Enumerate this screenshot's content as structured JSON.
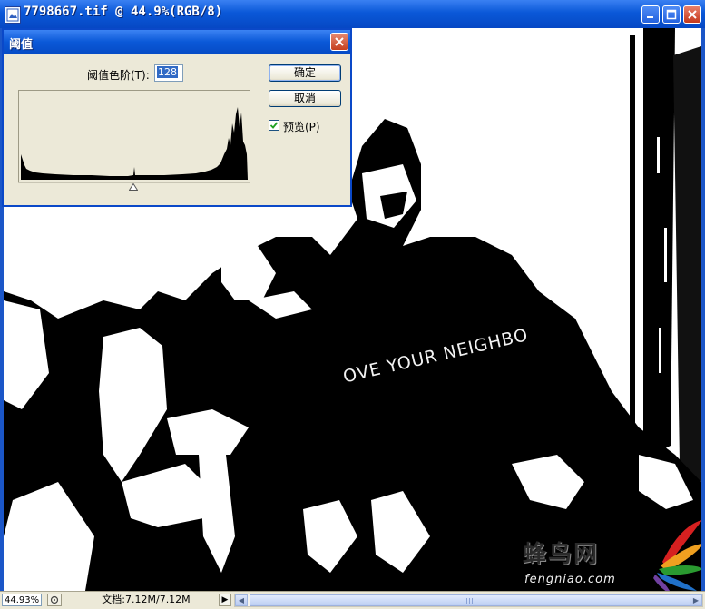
{
  "window": {
    "title": "7798667.tif @ 44.9%(RGB/8)"
  },
  "photo": {
    "tshirt_text": "OVE YOUR NEIGHBO"
  },
  "watermark": {
    "site_cn": "蜂鸟网",
    "site_en": "fengniao.com"
  },
  "statusbar": {
    "zoom": "44.93%",
    "doc_size": "文档:7.12M/7.12M"
  },
  "dialog": {
    "title": "阈值",
    "level_label": "阈值色阶(T):",
    "level_value": "128",
    "ok_label": "确定",
    "cancel_label": "取消",
    "preview_label": "预览(P)",
    "preview_checked": true,
    "histogram_icon": "histogram-graph",
    "slider_level": 128
  },
  "colors": {
    "titlebar": "#0a58d8",
    "dialog_bg": "#ece9d8",
    "selection": "#316ac5"
  }
}
